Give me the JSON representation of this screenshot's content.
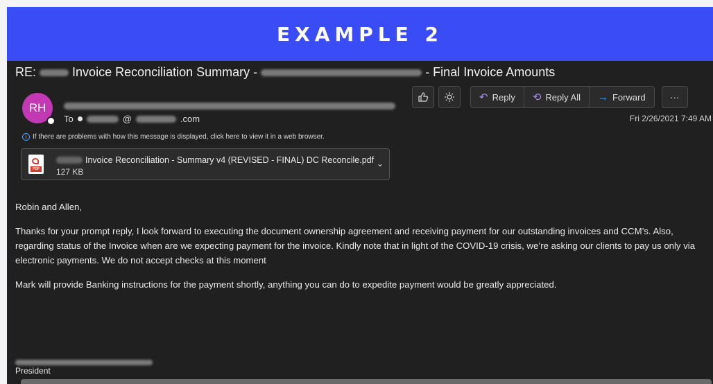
{
  "banner": {
    "title": "EXAMPLE 2"
  },
  "email": {
    "subject_prefix": "RE:",
    "subject_part1": "Invoice Reconciliation Summary -",
    "subject_part2": "- Final Invoice Amounts",
    "avatar_initials": "RH",
    "to_label": "To",
    "to_domain_suffix": ".com",
    "date": "Fri 2/26/2021 7:49 AM",
    "info_text": "If there are problems with how this message is displayed, click here to view it in a web browser.",
    "attachment": {
      "name": "Invoice Reconciliation - Summary v4 (REVISED - FINAL) DC Reconcile.pdf",
      "size": "127 KB",
      "icon": "pdf-icon",
      "icon_label": "PDF"
    },
    "body": {
      "greeting": "Robin and Allen,",
      "paragraph1": "Thanks for your prompt reply,  I look forward to executing the document ownership agreement and receiving payment for our outstanding invoices and CCM’s. Also, regarding status of the Invoice when are we expecting payment for the invoice. Kindly note that in light of the COVID-19 crisis, we’re asking our clients to pay us only via electronic payments. We do not accept checks at this moment",
      "paragraph2": "Mark will provide Banking instructions for the payment shortly, anything you can do to expedite payment would be greatly appreciated."
    },
    "signature_title": "President"
  },
  "toolbar": {
    "like_icon": "thumbs-up-icon",
    "theme_icon": "sun-icon",
    "reply_label": "Reply",
    "reply_all_label": "Reply All",
    "forward_label": "Forward",
    "more_label": "···"
  },
  "colors": {
    "banner": "#3a4cf5",
    "mail_background": "#202020",
    "avatar": "#c239b3"
  }
}
